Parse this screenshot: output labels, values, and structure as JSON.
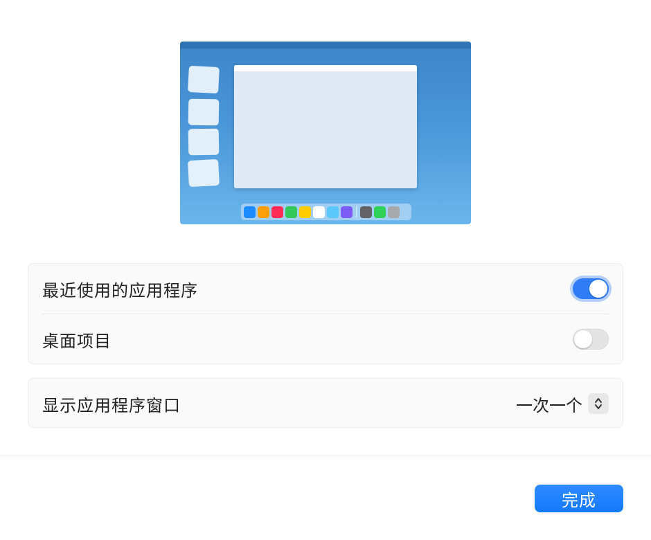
{
  "preview": {
    "dock_colors": [
      "#1a8cff",
      "#ff9f0a",
      "#ff2d55",
      "#34c759",
      "#ffcc00",
      "#ffffff",
      "#5ac8fa",
      "#7d5cf5",
      "#636366",
      "#30d158",
      "#a7a9ac"
    ]
  },
  "settings": {
    "recent_apps": {
      "label": "最近使用的应用程序",
      "enabled": true
    },
    "desktop_items": {
      "label": "桌面项目",
      "enabled": false
    },
    "show_windows": {
      "label": "显示应用程序窗口",
      "value": "一次一个"
    }
  },
  "footer": {
    "done_label": "完成"
  },
  "colors": {
    "accent": "#137afc",
    "toggle_on": "#2f7cf6"
  }
}
